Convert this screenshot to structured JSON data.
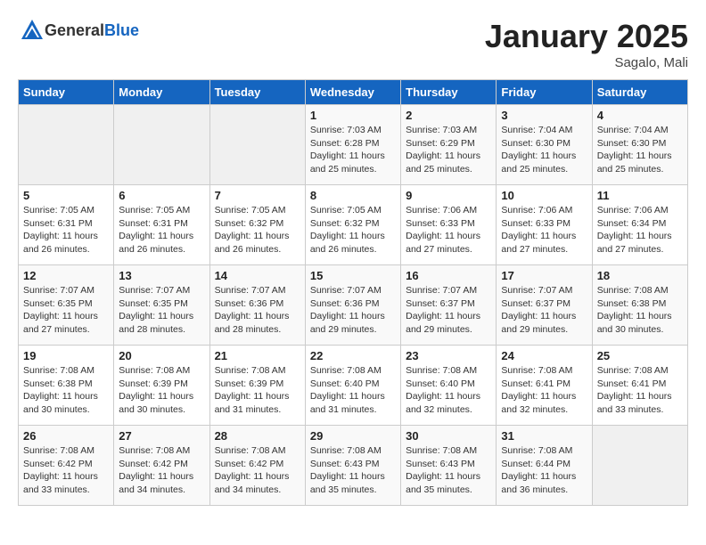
{
  "header": {
    "logo_general": "General",
    "logo_blue": "Blue",
    "month": "January 2025",
    "location": "Sagalo, Mali"
  },
  "days_of_week": [
    "Sunday",
    "Monday",
    "Tuesday",
    "Wednesday",
    "Thursday",
    "Friday",
    "Saturday"
  ],
  "weeks": [
    [
      {
        "day": "",
        "info": ""
      },
      {
        "day": "",
        "info": ""
      },
      {
        "day": "",
        "info": ""
      },
      {
        "day": "1",
        "info": "Sunrise: 7:03 AM\nSunset: 6:28 PM\nDaylight: 11 hours\nand 25 minutes."
      },
      {
        "day": "2",
        "info": "Sunrise: 7:03 AM\nSunset: 6:29 PM\nDaylight: 11 hours\nand 25 minutes."
      },
      {
        "day": "3",
        "info": "Sunrise: 7:04 AM\nSunset: 6:30 PM\nDaylight: 11 hours\nand 25 minutes."
      },
      {
        "day": "4",
        "info": "Sunrise: 7:04 AM\nSunset: 6:30 PM\nDaylight: 11 hours\nand 25 minutes."
      }
    ],
    [
      {
        "day": "5",
        "info": "Sunrise: 7:05 AM\nSunset: 6:31 PM\nDaylight: 11 hours\nand 26 minutes."
      },
      {
        "day": "6",
        "info": "Sunrise: 7:05 AM\nSunset: 6:31 PM\nDaylight: 11 hours\nand 26 minutes."
      },
      {
        "day": "7",
        "info": "Sunrise: 7:05 AM\nSunset: 6:32 PM\nDaylight: 11 hours\nand 26 minutes."
      },
      {
        "day": "8",
        "info": "Sunrise: 7:05 AM\nSunset: 6:32 PM\nDaylight: 11 hours\nand 26 minutes."
      },
      {
        "day": "9",
        "info": "Sunrise: 7:06 AM\nSunset: 6:33 PM\nDaylight: 11 hours\nand 27 minutes."
      },
      {
        "day": "10",
        "info": "Sunrise: 7:06 AM\nSunset: 6:33 PM\nDaylight: 11 hours\nand 27 minutes."
      },
      {
        "day": "11",
        "info": "Sunrise: 7:06 AM\nSunset: 6:34 PM\nDaylight: 11 hours\nand 27 minutes."
      }
    ],
    [
      {
        "day": "12",
        "info": "Sunrise: 7:07 AM\nSunset: 6:35 PM\nDaylight: 11 hours\nand 27 minutes."
      },
      {
        "day": "13",
        "info": "Sunrise: 7:07 AM\nSunset: 6:35 PM\nDaylight: 11 hours\nand 28 minutes."
      },
      {
        "day": "14",
        "info": "Sunrise: 7:07 AM\nSunset: 6:36 PM\nDaylight: 11 hours\nand 28 minutes."
      },
      {
        "day": "15",
        "info": "Sunrise: 7:07 AM\nSunset: 6:36 PM\nDaylight: 11 hours\nand 29 minutes."
      },
      {
        "day": "16",
        "info": "Sunrise: 7:07 AM\nSunset: 6:37 PM\nDaylight: 11 hours\nand 29 minutes."
      },
      {
        "day": "17",
        "info": "Sunrise: 7:07 AM\nSunset: 6:37 PM\nDaylight: 11 hours\nand 29 minutes."
      },
      {
        "day": "18",
        "info": "Sunrise: 7:08 AM\nSunset: 6:38 PM\nDaylight: 11 hours\nand 30 minutes."
      }
    ],
    [
      {
        "day": "19",
        "info": "Sunrise: 7:08 AM\nSunset: 6:38 PM\nDaylight: 11 hours\nand 30 minutes."
      },
      {
        "day": "20",
        "info": "Sunrise: 7:08 AM\nSunset: 6:39 PM\nDaylight: 11 hours\nand 30 minutes."
      },
      {
        "day": "21",
        "info": "Sunrise: 7:08 AM\nSunset: 6:39 PM\nDaylight: 11 hours\nand 31 minutes."
      },
      {
        "day": "22",
        "info": "Sunrise: 7:08 AM\nSunset: 6:40 PM\nDaylight: 11 hours\nand 31 minutes."
      },
      {
        "day": "23",
        "info": "Sunrise: 7:08 AM\nSunset: 6:40 PM\nDaylight: 11 hours\nand 32 minutes."
      },
      {
        "day": "24",
        "info": "Sunrise: 7:08 AM\nSunset: 6:41 PM\nDaylight: 11 hours\nand 32 minutes."
      },
      {
        "day": "25",
        "info": "Sunrise: 7:08 AM\nSunset: 6:41 PM\nDaylight: 11 hours\nand 33 minutes."
      }
    ],
    [
      {
        "day": "26",
        "info": "Sunrise: 7:08 AM\nSunset: 6:42 PM\nDaylight: 11 hours\nand 33 minutes."
      },
      {
        "day": "27",
        "info": "Sunrise: 7:08 AM\nSunset: 6:42 PM\nDaylight: 11 hours\nand 34 minutes."
      },
      {
        "day": "28",
        "info": "Sunrise: 7:08 AM\nSunset: 6:42 PM\nDaylight: 11 hours\nand 34 minutes."
      },
      {
        "day": "29",
        "info": "Sunrise: 7:08 AM\nSunset: 6:43 PM\nDaylight: 11 hours\nand 35 minutes."
      },
      {
        "day": "30",
        "info": "Sunrise: 7:08 AM\nSunset: 6:43 PM\nDaylight: 11 hours\nand 35 minutes."
      },
      {
        "day": "31",
        "info": "Sunrise: 7:08 AM\nSunset: 6:44 PM\nDaylight: 11 hours\nand 36 minutes."
      },
      {
        "day": "",
        "info": ""
      }
    ]
  ]
}
